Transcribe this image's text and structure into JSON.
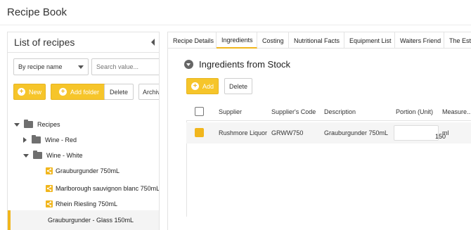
{
  "app": {
    "title": "Recipe Book"
  },
  "left_panel": {
    "title": "List of recipes",
    "filter_select": "By recipe name",
    "search_placeholder": "Search value...",
    "buttons": {
      "new": "New",
      "add_folder": "Add folder",
      "delete": "Delete",
      "archive": "Archiv"
    },
    "tree": {
      "root": "Recipes",
      "folders": [
        {
          "label": "Wine - Red",
          "expanded": false
        },
        {
          "label": "Wine - White",
          "expanded": true
        }
      ],
      "recipes": [
        "Grauburgunder 750mL",
        "Marlborough sauvignon blanc 750mL",
        "Rhein Riesling 750mL",
        "Grauburgunder - Glass 150mL"
      ]
    }
  },
  "tabs": [
    "Recipe Details",
    "Ingredients",
    "Costing",
    "Nutritional Facts",
    "Equipment List",
    "Waiters Friend",
    "The Esti"
  ],
  "active_tab": "Ingredients",
  "section": {
    "title": "Ingredients from Stock",
    "buttons": {
      "add": "Add",
      "delete": "Delete"
    }
  },
  "table": {
    "columns": [
      "Supplier",
      "Supplier's Code",
      "Description",
      "Portion (Unit)",
      "Measure..."
    ],
    "rows": [
      {
        "supplier": "Rushmore Liquor",
        "code": "GRWW750",
        "description": "Grauburgunder 750mL",
        "portion": "150",
        "measure": "ml",
        "checked": true
      }
    ]
  },
  "colors": {
    "accent": "#f1b61d",
    "icon_gray": "#6f6f6f"
  }
}
